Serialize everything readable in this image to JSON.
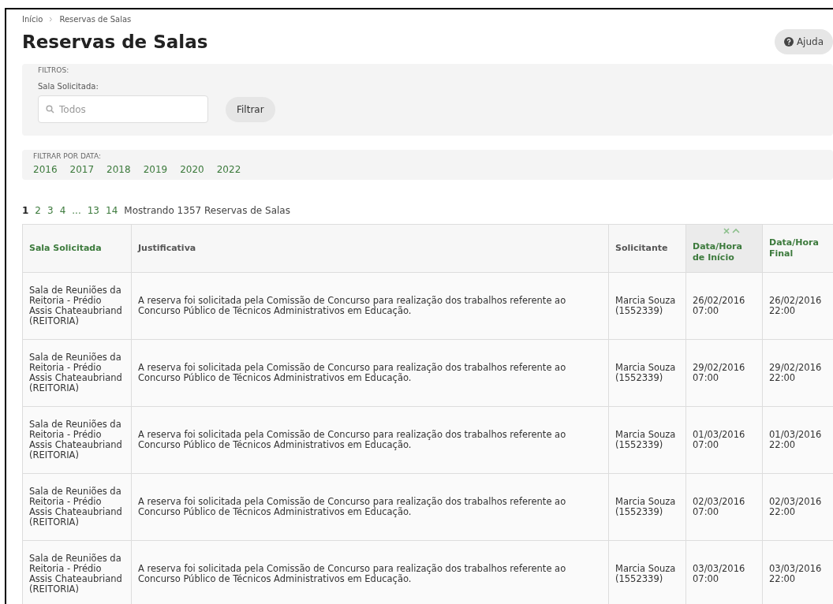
{
  "breadcrumb": [
    "Início",
    "Reservas de Salas"
  ],
  "title": "Reservas de Salas",
  "help_button": "Ajuda",
  "filters": {
    "heading": "FILTROS:",
    "field_label": "Sala Solicitada:",
    "placeholder": "Todos",
    "button": "Filtrar"
  },
  "date_filter": {
    "heading": "FILTRAR POR DATA:",
    "years": [
      "2016",
      "2017",
      "2018",
      "2019",
      "2020",
      "2022"
    ]
  },
  "pagination": {
    "pages": [
      {
        "label": "1",
        "selected": true
      },
      {
        "label": "2",
        "selected": false
      },
      {
        "label": "3",
        "selected": false
      },
      {
        "label": "4",
        "selected": false
      },
      {
        "label": "...",
        "selected": false
      },
      {
        "label": "13",
        "selected": false
      },
      {
        "label": "14",
        "selected": false
      }
    ],
    "summary": "Mostrando 1357 Reservas de Salas"
  },
  "table": {
    "columns": [
      {
        "label": "Sala Solicitada",
        "sortable": true,
        "sorted": false
      },
      {
        "label": "Justificativa",
        "sortable": false,
        "sorted": false
      },
      {
        "label": "Solicitante",
        "sortable": false,
        "sorted": false
      },
      {
        "label": "Data/Hora de Início",
        "sortable": true,
        "sorted": true
      },
      {
        "label": "Data/Hora Final",
        "sortable": true,
        "sorted": false
      }
    ],
    "rows": [
      [
        "Sala de Reuniões da Reitoria - Prédio Assis Chateaubriand (REITORIA)",
        "A reserva foi solicitada pela Comissão de Concurso para realização dos trabalhos referente ao Concurso Público de Técnicos Administrativos em Educação.",
        "Marcia Souza (1552339)",
        "26/02/2016 07:00",
        "26/02/2016 22:00"
      ],
      [
        "Sala de Reuniões da Reitoria - Prédio Assis Chateaubriand (REITORIA)",
        "A reserva foi solicitada pela Comissão de Concurso para realização dos trabalhos referente ao Concurso Público de Técnicos Administrativos em Educação.",
        "Marcia Souza (1552339)",
        "29/02/2016 07:00",
        "29/02/2016 22:00"
      ],
      [
        "Sala de Reuniões da Reitoria - Prédio Assis Chateaubriand (REITORIA)",
        "A reserva foi solicitada pela Comissão de Concurso para realização dos trabalhos referente ao Concurso Público de Técnicos Administrativos em Educação.",
        "Marcia Souza (1552339)",
        "01/03/2016 07:00",
        "01/03/2016 22:00"
      ],
      [
        "Sala de Reuniões da Reitoria - Prédio Assis Chateaubriand (REITORIA)",
        "A reserva foi solicitada pela Comissão de Concurso para realização dos trabalhos referente ao Concurso Público de Técnicos Administrativos em Educação.",
        "Marcia Souza (1552339)",
        "02/03/2016 07:00",
        "02/03/2016 22:00"
      ],
      [
        "Sala de Reuniões da Reitoria - Prédio Assis Chateaubriand (REITORIA)",
        "A reserva foi solicitada pela Comissão de Concurso para realização dos trabalhos referente ao Concurso Público de Técnicos Administrativos em Educação.",
        "Marcia Souza (1552339)",
        "03/03/2016 07:00",
        "03/03/2016 22:00"
      ]
    ]
  }
}
